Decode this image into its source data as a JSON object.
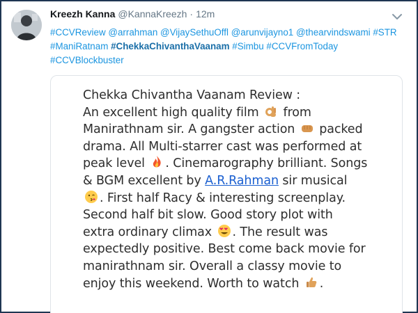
{
  "tweet": {
    "display_name": "Kreezh Kanna",
    "handle": "@KannaKreezh",
    "separator": "·",
    "time": "12m",
    "hashtag_tokens": [
      "#CCVReview",
      "@arrahman",
      "@VijaySethuOffl",
      "@arunvijayno1",
      "@thearvindswami",
      "#STR",
      "#ManiRatnam",
      "#ChekkaChivanthaVaanam",
      "#Simbu",
      "#CCVFromToday",
      "#CCVBlockbuster"
    ],
    "bold_token": "#ChekkaChivanthaVaanam",
    "menu_icon": "chevron-down-icon",
    "avatar_icon": "user-photo"
  },
  "review": {
    "segments": [
      {
        "text": "Chekka Chivantha Vaanam Review :"
      },
      {
        "br": true
      },
      {
        "text": "An excellent high quality film "
      },
      {
        "emoji": "ok-hand"
      },
      {
        "text": " from"
      },
      {
        "br": true
      },
      {
        "text": "Manirathnam sir. A gangster action "
      },
      {
        "emoji": "fist"
      },
      {
        "text": " packed"
      },
      {
        "br": true
      },
      {
        "text": "drama. All Multi-starrer cast was performed at"
      },
      {
        "br": true
      },
      {
        "text": "peak level "
      },
      {
        "emoji": "fire"
      },
      {
        "text": ". Cinemarography brilliant. Songs"
      },
      {
        "br": true
      },
      {
        "text": "& BGM excellent by "
      },
      {
        "link": "A.R.Rahman"
      },
      {
        "text": " sir musical"
      },
      {
        "br": true
      },
      {
        "emoji": "kiss-face"
      },
      {
        "text": ". First half Racy & interesting screenplay."
      },
      {
        "br": true
      },
      {
        "text": "Second half bit slow. Good story plot with"
      },
      {
        "br": true
      },
      {
        "text": "extra ordinary climax "
      },
      {
        "emoji": "heart-eyes"
      },
      {
        "text": ". The result was"
      },
      {
        "br": true
      },
      {
        "text": "expectedly positive. Best come back movie for"
      },
      {
        "br": true
      },
      {
        "text": "manirathnam sir. Overall a classy movie to"
      },
      {
        "br": true
      },
      {
        "text": "enjoy this weekend. Worth to watch "
      },
      {
        "emoji": "thumbs-up"
      },
      {
        "text": "."
      }
    ]
  },
  "colors": {
    "link": "#1b95e0",
    "bold_tag": "#1b6fa8",
    "frame": "#1f3552",
    "text": "#2d2d2d"
  }
}
